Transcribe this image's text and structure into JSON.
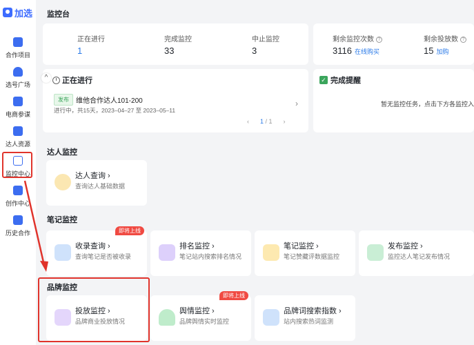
{
  "app": {
    "logo_text": "加选"
  },
  "sidebar": {
    "items": [
      {
        "label": "合作项目",
        "icon": "project-icon"
      },
      {
        "label": "选号广场",
        "icon": "user-icon"
      },
      {
        "label": "电商参谋",
        "icon": "shopping-icon"
      },
      {
        "label": "达人资源",
        "icon": "star-icon"
      },
      {
        "label": "监控中心",
        "icon": "monitor-icon",
        "active": true
      },
      {
        "label": "创作中心",
        "icon": "ai-icon"
      },
      {
        "label": "历史合作",
        "icon": "history-icon"
      }
    ]
  },
  "header": {
    "title": "监控台"
  },
  "stats": {
    "running_label": "正在进行",
    "running_value": "1",
    "done_label": "完成监控",
    "done_value": "33",
    "stopped_label": "中止监控",
    "stopped_value": "3",
    "remaining_label": "剩余监控次数",
    "remaining_value": "3116",
    "buy_link": "在线购买",
    "remaining_put_label": "剩余投放数",
    "remaining_put_value": "15",
    "add_link": "加购"
  },
  "running": {
    "title": "正在进行",
    "tag": "发布",
    "project": "维他合作达人101-200",
    "meta": "进行中，共15天，2023–04–27 至 2023–05–11",
    "page_current": "1",
    "page_total": "/ 1"
  },
  "alerts": {
    "title": "完成提醒",
    "empty_text": "暂无监控任务，点击下方各监控入"
  },
  "sections": {
    "influencer": {
      "title": "达人监控",
      "items": [
        {
          "title": "达人查询",
          "desc": "查询达人基础数据"
        }
      ]
    },
    "notes": {
      "title": "笔记监控",
      "items": [
        {
          "title": "收录查询",
          "desc": "查询笔记是否被收录",
          "badge": "即将上线"
        },
        {
          "title": "排名监控",
          "desc": "笔记站内搜索排名情况"
        },
        {
          "title": "笔记监控",
          "desc": "笔记赞藏评数据监控"
        },
        {
          "title": "发布监控",
          "desc": "监控达人笔记发布情况"
        }
      ]
    },
    "brand": {
      "title": "品牌监控",
      "items": [
        {
          "title": "投放监控",
          "desc": "品牌商业投放情况"
        },
        {
          "title": "舆情监控",
          "desc": "品牌舆情实时监控",
          "badge": "即将上线"
        },
        {
          "title": "品牌词搜索指数",
          "desc": "站内搜索热词监测"
        }
      ]
    }
  },
  "colors": {
    "accent": "#2a7ae8",
    "highlight": "#e0332b",
    "success": "#3ba55c"
  }
}
